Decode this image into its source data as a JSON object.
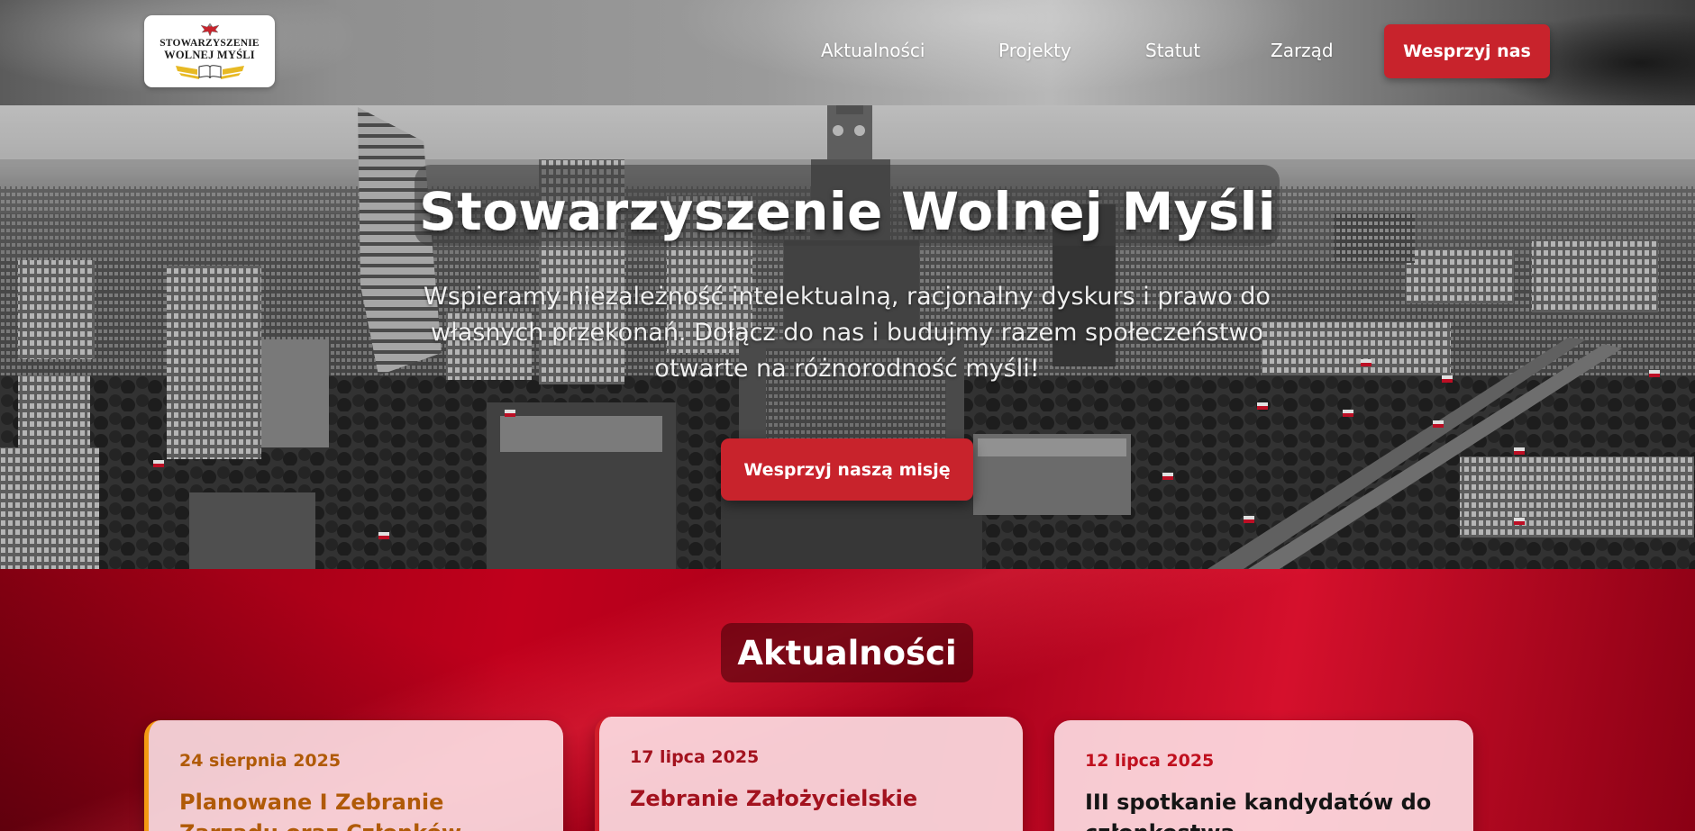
{
  "header": {
    "logo": {
      "line1": "STOWARZYSZENIE",
      "line2": "WOLNEJ MYŚLI",
      "eagle_icon": "white-eagle-icon",
      "book_icon": "open-book-icon"
    },
    "nav": [
      {
        "label": "Aktualności"
      },
      {
        "label": "Projekty"
      },
      {
        "label": "Statut"
      },
      {
        "label": "Zarząd"
      }
    ],
    "cta_label": "Wesprzyj nas"
  },
  "hero": {
    "title": "Stowarzyszenie Wolnej Myśli",
    "subtitle": "Wspieramy niezależność intelektualną, racjonalny dyskurs i prawo do własnych przekonań. Dołącz do nas i budujmy razem społeczeństwo otwarte na różnorodność myśli!",
    "cta_label": "Wesprzyj naszą misję"
  },
  "news": {
    "heading": "Aktualności",
    "items": [
      {
        "date": "24 sierpnia 2025",
        "title": "Planowane I Zebranie Zarządu oraz Członków"
      },
      {
        "date": "17 lipca 2025",
        "title": "Zebranie Założycielskie"
      },
      {
        "date": "12 lipca 2025",
        "title": "III spotkanie kandydatów do członkostwa"
      }
    ]
  },
  "colors": {
    "accent_red": "#c8232c",
    "flag_red": "#c0001c",
    "card_accent_orange": "#f39a12"
  }
}
